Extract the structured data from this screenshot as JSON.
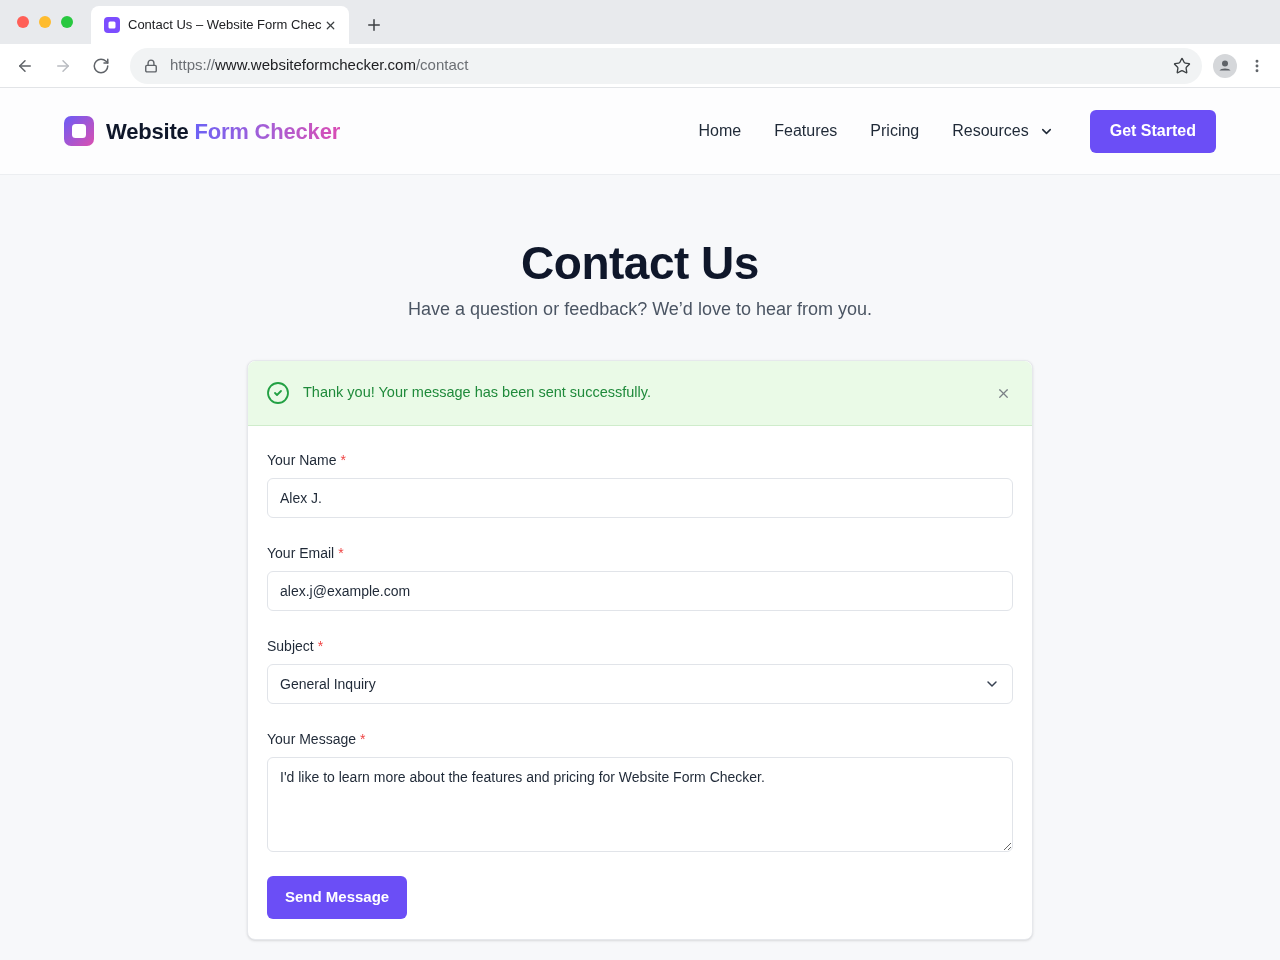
{
  "browser": {
    "tab": {
      "title": "Contact Us – Website Form Chec"
    },
    "nav_buttons": [
      {
        "kind": "back",
        "disabled": false
      },
      {
        "kind": "forward",
        "disabled": true
      },
      {
        "kind": "reload",
        "disabled": false
      }
    ],
    "address_bar": {
      "scheme": "https://",
      "host": "www.websiteformchecker.com",
      "path": "/contact"
    }
  },
  "header": {
    "brand": {
      "name": "Website",
      "accent": "Form Checker"
    },
    "nav": [
      {
        "label": "Home",
        "kind": "link"
      },
      {
        "label": "Features",
        "kind": "link"
      },
      {
        "label": "Pricing",
        "kind": "link"
      },
      {
        "label": "Resources",
        "kind": "dropdown"
      }
    ],
    "cta": "Get Started"
  },
  "page": {
    "title": "Contact Us",
    "subtitle": "Have a question or feedback? We’d love to hear from you."
  },
  "form": {
    "alert": {
      "kind": "success",
      "message": "Thank you! Your message has been sent successfully."
    },
    "fields": [
      {
        "kind": "text",
        "label": "Your Name",
        "required_mark": "*",
        "value": "Alex J."
      },
      {
        "kind": "text",
        "label": "Your Email",
        "required_mark": "*",
        "value": "alex.j@example.com"
      },
      {
        "kind": "select",
        "label": "Subject",
        "required_mark": "*",
        "value": "General Inquiry"
      },
      {
        "kind": "textarea",
        "label": "Your Message",
        "required_mark": "*",
        "value": "I'd like to learn more about the features and pricing for Website Form Checker."
      }
    ],
    "submit": "Send Message"
  }
}
